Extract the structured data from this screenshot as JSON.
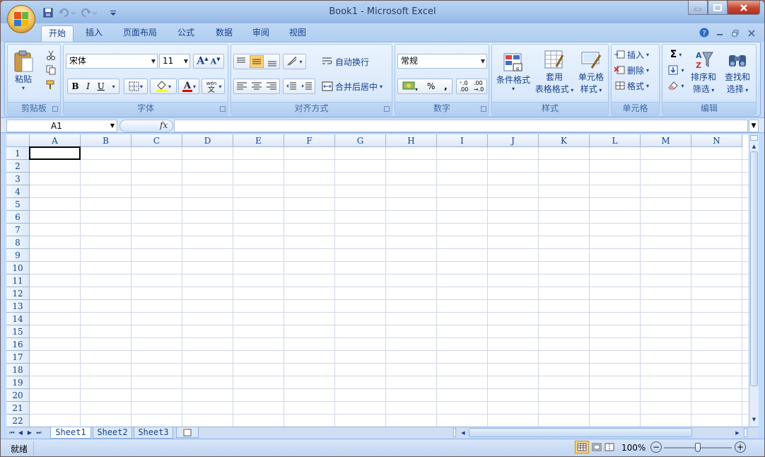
{
  "window": {
    "title": "Book1 - Microsoft Excel"
  },
  "tabs": [
    "开始",
    "插入",
    "页面布局",
    "公式",
    "数据",
    "审阅",
    "视图"
  ],
  "groups": {
    "clipboard": {
      "label": "剪贴板",
      "paste": "粘贴"
    },
    "font": {
      "label": "字体",
      "font_name": "宋体",
      "font_size": "11"
    },
    "alignment": {
      "label": "对齐方式",
      "wrap": "自动换行",
      "merge": "合并后居中"
    },
    "number": {
      "label": "数字",
      "format": "常规"
    },
    "styles": {
      "label": "样式",
      "cond_format": "条件格式",
      "table_format_1": "套用",
      "table_format_2": "表格格式",
      "cell_styles_1": "单元格",
      "cell_styles_2": "样式"
    },
    "cells": {
      "label": "单元格",
      "insert": "插入",
      "delete": "删除",
      "format": "格式"
    },
    "editing": {
      "label": "编辑",
      "sort_1": "排序和",
      "sort_2": "筛选",
      "find_1": "查找和",
      "find_2": "选择"
    }
  },
  "formula_bar": {
    "name_box": "A1",
    "fx": "fx"
  },
  "columns": [
    "A",
    "B",
    "C",
    "D",
    "E",
    "F",
    "G",
    "H",
    "I",
    "J",
    "K",
    "L",
    "M",
    "N"
  ],
  "rows": [
    "1",
    "2",
    "3",
    "4",
    "5",
    "6",
    "7",
    "8",
    "9",
    "10",
    "11",
    "12",
    "13",
    "14",
    "15",
    "16",
    "17",
    "18",
    "19",
    "20",
    "21",
    "22"
  ],
  "sheets": [
    "Sheet1",
    "Sheet2",
    "Sheet3"
  ],
  "status": {
    "ready": "就绪",
    "zoom": "100%"
  },
  "colors": {
    "accent": "#15428b",
    "ribbon": "#d4e5fa",
    "grid_line": "#d0d7e5"
  }
}
